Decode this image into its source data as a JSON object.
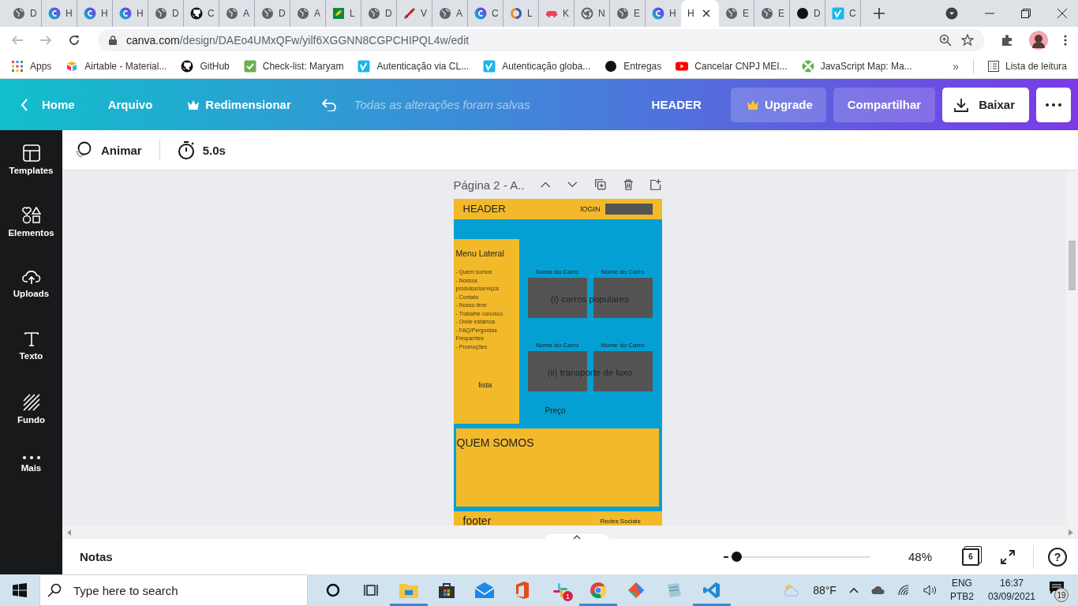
{
  "browser": {
    "tabs": [
      {
        "kind": "globe",
        "label": "D",
        "selected": false
      },
      {
        "kind": "canva",
        "label": "H",
        "selected": false
      },
      {
        "kind": "canva",
        "label": "H",
        "selected": false
      },
      {
        "kind": "canva",
        "label": "H",
        "selected": false
      },
      {
        "kind": "globe",
        "label": "D",
        "selected": false
      },
      {
        "kind": "github",
        "label": "C",
        "selected": false
      },
      {
        "kind": "globe",
        "label": "A",
        "selected": false
      },
      {
        "kind": "globe",
        "label": "D",
        "selected": false
      },
      {
        "kind": "globe",
        "label": "A",
        "selected": false
      },
      {
        "kind": "sheet",
        "label": "L",
        "selected": false
      },
      {
        "kind": "globe",
        "label": "D",
        "selected": false
      },
      {
        "kind": "tool",
        "label": "V",
        "selected": false
      },
      {
        "kind": "globe",
        "label": "A",
        "selected": false
      },
      {
        "kind": "canva",
        "label": "C",
        "selected": false
      },
      {
        "kind": "orange",
        "label": "L",
        "selected": false
      },
      {
        "kind": "car",
        "label": "K",
        "selected": false
      },
      {
        "kind": "chrome",
        "label": "N",
        "selected": false
      },
      {
        "kind": "globe",
        "label": "E",
        "selected": false
      },
      {
        "kind": "canva",
        "label": "H",
        "selected": false
      },
      {
        "kind": "none",
        "label": "H",
        "selected": true
      },
      {
        "kind": "globe",
        "label": "E",
        "selected": false
      },
      {
        "kind": "globe",
        "label": "E",
        "selected": false
      },
      {
        "kind": "dot",
        "label": "D",
        "selected": false
      },
      {
        "kind": "vimeo",
        "label": "C",
        "selected": false
      }
    ],
    "url_host": "canva.com",
    "url_path": "/design/DAEo4UMxQFw/yilf6XGGNN8CGPCHIPQL4w/edit",
    "bookmarks": [
      {
        "kind": "apps",
        "label": "Apps"
      },
      {
        "kind": "airtable",
        "label": "Airtable - Material..."
      },
      {
        "kind": "github",
        "label": "GitHub"
      },
      {
        "kind": "check",
        "label": "Check-list: Maryam"
      },
      {
        "kind": "vimeo",
        "label": "Autenticação via CL..."
      },
      {
        "kind": "vimeo",
        "label": "Autenticação globa..."
      },
      {
        "kind": "dot",
        "label": "Entregas"
      },
      {
        "kind": "youtube",
        "label": "Cancelar CNPJ MEI..."
      },
      {
        "kind": "jsmap",
        "label": "JavaScript Map: Ma..."
      }
    ],
    "more": "»",
    "reading_list": "Lista de leitura"
  },
  "editor_bar": {
    "home": "Home",
    "file": "Arquivo",
    "resize": "Redimensionar",
    "save_status": "Todas as alterações foram salvas",
    "design_title": "HEADER",
    "upgrade": "Upgrade",
    "share": "Compartilhar",
    "download": "Baixar"
  },
  "side_panel": [
    {
      "kind": "templates",
      "label": "Templates"
    },
    {
      "kind": "elements",
      "label": "Elementos"
    },
    {
      "kind": "uploads",
      "label": "Uploads"
    },
    {
      "kind": "text",
      "label": "Texto"
    },
    {
      "kind": "background",
      "label": "Fundo"
    },
    {
      "kind": "more",
      "label": "Mais"
    }
  ],
  "toolbar": {
    "animate": "Animar",
    "duration": "5.0s"
  },
  "page": {
    "title": "Página 2 - A.."
  },
  "design": {
    "header": "HEADER",
    "login": "lOGIN",
    "menu_title": "Menu Lateral",
    "menu_items": [
      "- Quem somos",
      "- Nossos produtos/serviços",
      "- Contato",
      "- Nosso time",
      "- Trabalhe conosco",
      "- Onde estamos",
      "- FAQ/Perguntas Frequentes",
      "- Promoções"
    ],
    "list_label": "lista",
    "car_rows": [
      {
        "names": [
          "Nome do Carro",
          "Nome do Carro"
        ],
        "caption": "(i) carros populares"
      },
      {
        "names": [
          "Nome do Carro",
          "Nome do Carro"
        ],
        "caption": "(ii) transporte de luxo"
      }
    ],
    "price": "Preço",
    "about": "QUEM SOMOS",
    "footer": "footer",
    "social": "Redes Sociais"
  },
  "bottom_bar": {
    "notes": "Notas",
    "zoom": {
      "level": 0.03
    },
    "zoom_reading": "48%",
    "page_count": "6",
    "help": "?"
  },
  "taskbar": {
    "search_placeholder": "Type here to search",
    "apps": [
      {
        "kind": "cortana",
        "open": false
      },
      {
        "kind": "taskview",
        "open": false
      },
      {
        "kind": "explorer",
        "open": true
      },
      {
        "kind": "store",
        "open": false
      },
      {
        "kind": "mail",
        "open": false
      },
      {
        "kind": "office",
        "open": false
      },
      {
        "kind": "slack",
        "open": false,
        "badge": "1"
      },
      {
        "kind": "chrome",
        "open": true
      },
      {
        "kind": "sourcetree",
        "open": false
      },
      {
        "kind": "notepad",
        "open": false
      },
      {
        "kind": "vscode",
        "open": true
      }
    ],
    "weather": "88°F",
    "lang_top": "ENG",
    "lang_bottom": "PTB2",
    "time": "16:37",
    "date": "03/09/2021",
    "notifications": "19"
  }
}
